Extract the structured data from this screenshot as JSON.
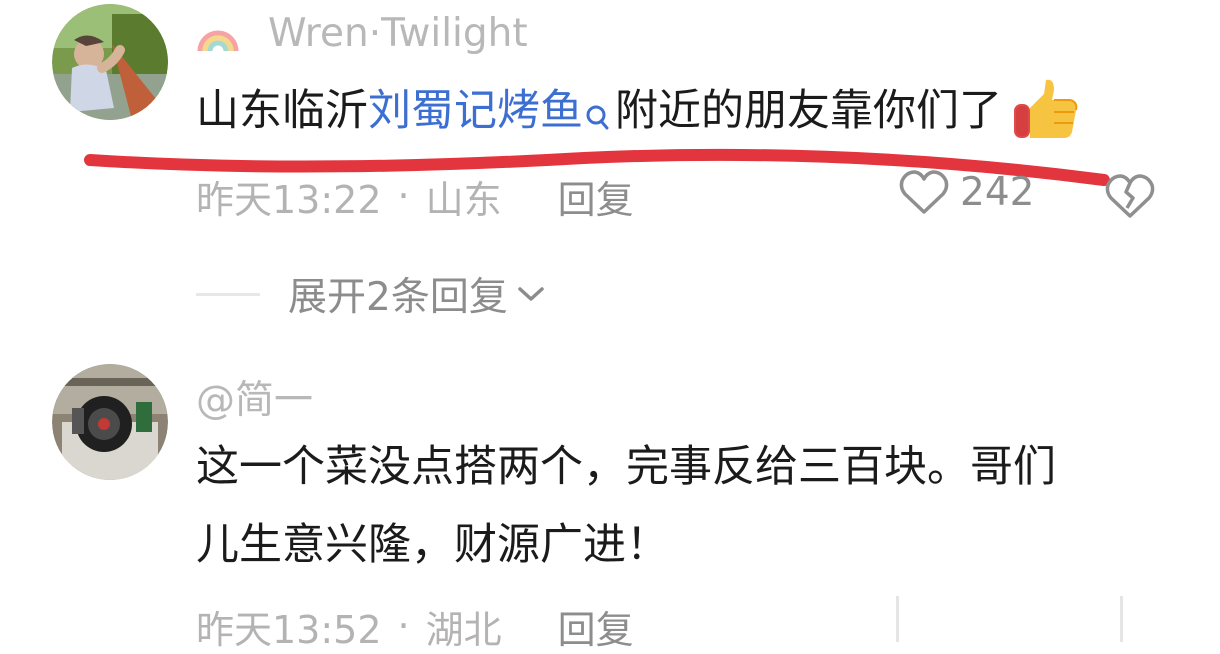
{
  "comments": [
    {
      "author": "Wren·Twilight",
      "text_prefix": "山东临沂",
      "text_link": "刘蜀记烤鱼",
      "text_suffix": "附近的朋友靠你们了",
      "time": "昨天13:22",
      "location": "山东",
      "reply_label": "回复",
      "likes": "242",
      "expand_label": "展开2条回复"
    },
    {
      "author": "@简一",
      "text_line1": "这一个菜没点搭两个，完事反给三百块。哥们",
      "text_line2": "儿生意兴隆，财源广进！",
      "time": "昨天13:52",
      "location": "湖北",
      "reply_label": "回复"
    }
  ],
  "meta_separator": "·",
  "colors": {
    "link": "#3c6fd1",
    "annotation": "#e3353d",
    "meta": "#b3b3b3",
    "reply": "#8d8d8d"
  }
}
